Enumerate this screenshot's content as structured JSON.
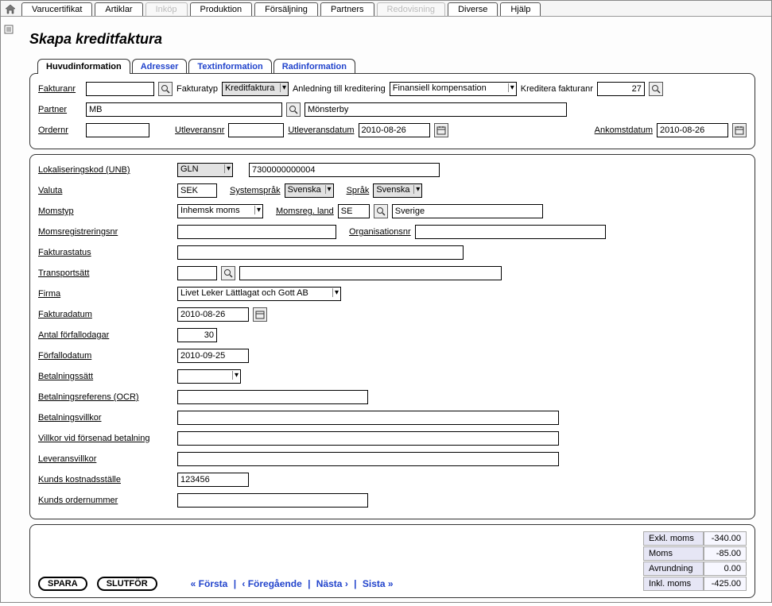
{
  "menu": {
    "items": [
      {
        "label": "Varucertifikat",
        "disabled": false
      },
      {
        "label": "Artiklar",
        "disabled": false
      },
      {
        "label": "Inköp",
        "disabled": true
      },
      {
        "label": "Produktion",
        "disabled": false
      },
      {
        "label": "Försäljning",
        "disabled": false
      },
      {
        "label": "Partners",
        "disabled": false
      },
      {
        "label": "Redovisning",
        "disabled": true
      },
      {
        "label": "Diverse",
        "disabled": false
      },
      {
        "label": "Hjälp",
        "disabled": false
      }
    ]
  },
  "page_title": "Skapa kreditfaktura",
  "tabs": [
    {
      "label": "Huvudinformation",
      "active": true
    },
    {
      "label": "Adresser",
      "active": false
    },
    {
      "label": "Textinformation",
      "active": false
    },
    {
      "label": "Radinformation",
      "active": false
    }
  ],
  "head": {
    "fakturanr_label": "Fakturanr",
    "fakturanr": "",
    "fakturatyp_label": "Fakturatyp",
    "fakturatyp": "Kreditfaktura",
    "anledning_label": "Anledning till kreditering",
    "anledning": "Finansiell kompensation",
    "kreditera_label": "Kreditera fakturanr",
    "kreditera": "27",
    "partner_label": "Partner",
    "partner_code": "MB",
    "partner_name": "Mönsterby",
    "ordernr_label": "Ordernr",
    "ordernr": "",
    "utleveransnr_label": "Utleveransnr",
    "utleveransnr": "",
    "utleveransdatum_label": "Utleveransdatum",
    "utleveransdatum": "2010-08-26",
    "ankomstdatum_label": "Ankomstdatum",
    "ankomstdatum": "2010-08-26"
  },
  "body": {
    "lokaliseringskod_label": "Lokaliseringskod (UNB)",
    "lokaliseringskod_type": "GLN",
    "lokaliseringskod_value": "7300000000004",
    "valuta_label": "Valuta",
    "valuta": "SEK",
    "systemsprak_label": "Systemspråk",
    "systemsprak": "Svenska",
    "sprak_label": "Språk",
    "sprak": "Svenska",
    "momstyp_label": "Momstyp",
    "momstyp": "Inhemsk moms",
    "momsreg_land_label": "Momsreg. land",
    "momsreg_land_code": "SE",
    "momsreg_land_name": "Sverige",
    "momsregnr_label": "Momsregistreringsnr",
    "momsregnr": "",
    "orgnr_label": "Organisationsnr",
    "orgnr": "",
    "fakturastatus_label": "Fakturastatus",
    "fakturastatus": "",
    "transportsatt_label": "Transportsätt",
    "transportsatt_code": "",
    "transportsatt_name": "",
    "firma_label": "Firma",
    "firma": "Livet Leker Lättlagat och Gott AB",
    "fakturadatum_label": "Fakturadatum",
    "fakturadatum": "2010-08-26",
    "forfallodagar_label": "Antal förfallodagar",
    "forfallodagar": "30",
    "forfallodatum_label": "Förfallodatum",
    "forfallodatum": "2010-09-25",
    "betalningssatt_label": "Betalningssätt",
    "betalningssatt": "",
    "betalningsreferens_label": "Betalningsreferens (OCR)",
    "betalningsreferens": "",
    "betalningsvillkor_label": "Betalningsvillkor",
    "betalningsvillkor": "",
    "villkor_forsenad_label": "Villkor vid försenad betalning",
    "villkor_forsenad": "",
    "leveransvillkor_label": "Leveransvillkor",
    "leveransvillkor": "",
    "kostnadsstalle_label": "Kunds kostnadsställe",
    "kostnadsstalle": "123456",
    "ordernummer_label": "Kunds ordernummer",
    "ordernummer": ""
  },
  "footer": {
    "spara": "SPARA",
    "slutfor": "SLUTFÖR",
    "nav_first": "« Första",
    "nav_prev": "‹ Föregående",
    "nav_next": "Nästa ›",
    "nav_last": "Sista »",
    "totals": {
      "exkl_label": "Exkl. moms",
      "exkl": "-340.00",
      "moms_label": "Moms",
      "moms": "-85.00",
      "avrundning_label": "Avrundning",
      "avrundning": "0.00",
      "inkl_label": "Inkl. moms",
      "inkl": "-425.00"
    }
  }
}
